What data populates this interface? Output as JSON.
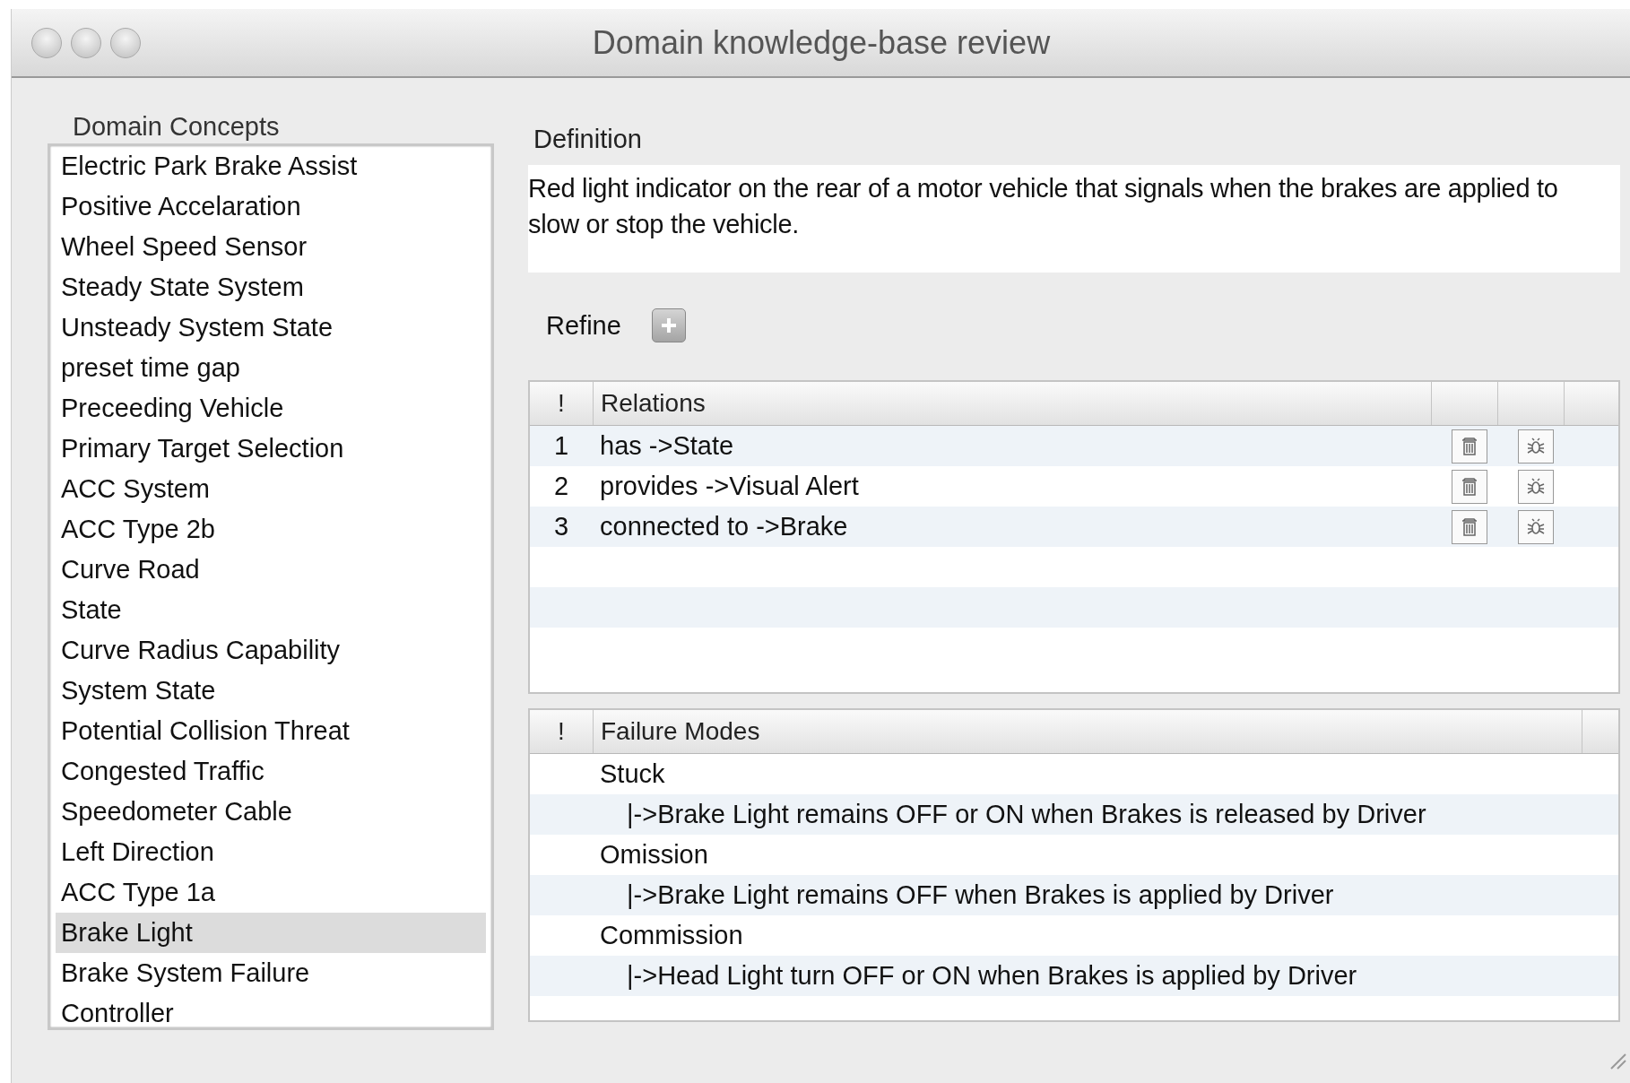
{
  "window": {
    "title": "Domain knowledge-base review"
  },
  "concepts": {
    "label": "Domain Concepts",
    "items": [
      {
        "label": "Electric Park Brake Assist",
        "selected": false
      },
      {
        "label": "Positive Accelaration",
        "selected": false
      },
      {
        "label": "Wheel Speed Sensor",
        "selected": false
      },
      {
        "label": "Steady State System",
        "selected": false
      },
      {
        "label": "Unsteady System State",
        "selected": false
      },
      {
        "label": "preset time gap",
        "selected": false
      },
      {
        "label": "Preceeding Vehicle",
        "selected": false
      },
      {
        "label": "Primary Target Selection",
        "selected": false
      },
      {
        "label": "ACC System",
        "selected": false
      },
      {
        "label": "ACC Type 2b",
        "selected": false
      },
      {
        "label": "Curve Road",
        "selected": false
      },
      {
        "label": "State",
        "selected": false
      },
      {
        "label": "Curve Radius Capability",
        "selected": false
      },
      {
        "label": "System State",
        "selected": false
      },
      {
        "label": "Potential Collision Threat",
        "selected": false
      },
      {
        "label": "Congested Traffic",
        "selected": false
      },
      {
        "label": "Speedometer Cable",
        "selected": false
      },
      {
        "label": "Left Direction",
        "selected": false
      },
      {
        "label": "ACC Type 1a",
        "selected": false
      },
      {
        "label": "Brake Light",
        "selected": true
      },
      {
        "label": "Brake System Failure",
        "selected": false
      },
      {
        "label": "Controller",
        "selected": false
      }
    ]
  },
  "definition": {
    "label": "Definition",
    "text": "Red light indicator on the rear of a motor vehicle that signals when the brakes are applied to slow or stop the vehicle."
  },
  "refine": {
    "label": "Refine"
  },
  "relations": {
    "columns": [
      "!",
      "Relations"
    ],
    "rows": [
      {
        "number": "1",
        "relation": "has ->State"
      },
      {
        "number": "2",
        "relation": "provides ->Visual Alert"
      },
      {
        "number": "3",
        "relation": "connected to ->Brake"
      }
    ]
  },
  "failure_modes": {
    "columns": [
      "!",
      "Failure Modes"
    ],
    "items": [
      {
        "label": "Stuck",
        "children": [
          {
            "label": "|->Brake Light remains OFF or ON when Brakes is released by Driver"
          }
        ]
      },
      {
        "label": "Omission",
        "children": [
          {
            "label": "|->Brake Light remains OFF when Brakes is applied by Driver"
          }
        ]
      },
      {
        "label": "Commission",
        "children": [
          {
            "label": "|->Head Light turn OFF or ON when Brakes is applied by Driver"
          }
        ]
      }
    ]
  }
}
